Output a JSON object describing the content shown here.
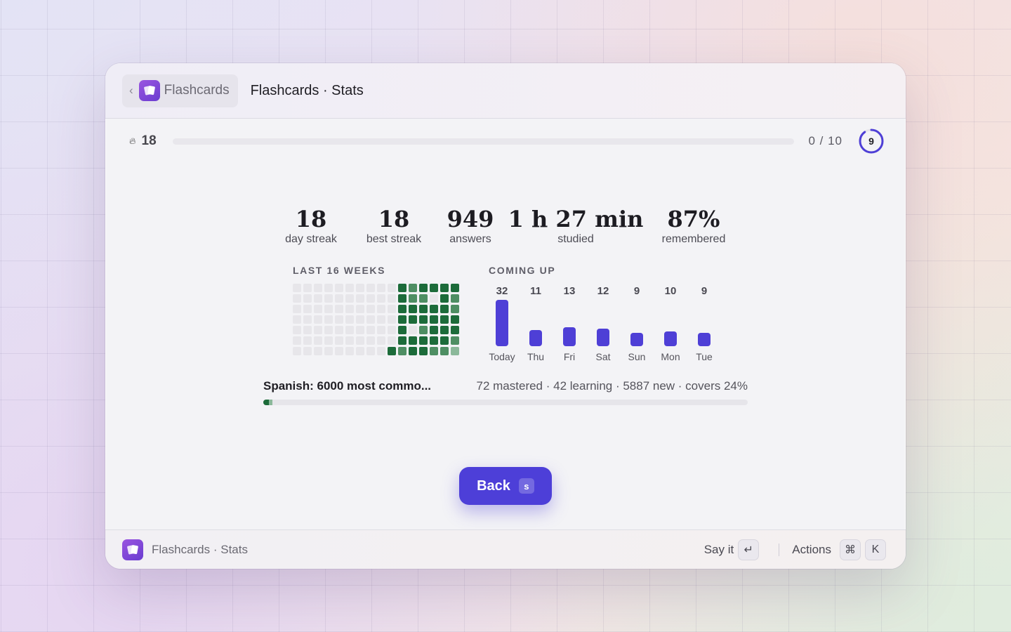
{
  "header": {
    "crumb_label": "Flashcards",
    "title": "Flashcards · Stats"
  },
  "progress": {
    "streak": "18",
    "count": "0 / 10",
    "ring_value": "9",
    "ring_fraction": 0.9,
    "accent": "#4e3fd6"
  },
  "stats": [
    {
      "value": "18",
      "label": "day streak"
    },
    {
      "value": "18",
      "label": "best streak"
    },
    {
      "value": "949",
      "label": "answers"
    },
    {
      "value": "1 h 27 min",
      "label": "studied"
    },
    {
      "value": "87%",
      "label": "remembered"
    }
  ],
  "heatmap": {
    "label": "LAST 16 WEEKS",
    "colors": {
      "0": "#e7e6ea",
      "1": "#8bb89a",
      "2": "#4e8e63",
      "3": "#1c6b3a"
    },
    "weeks": [
      [
        0,
        0,
        0,
        0,
        0,
        0,
        0
      ],
      [
        0,
        0,
        0,
        0,
        0,
        0,
        0
      ],
      [
        0,
        0,
        0,
        0,
        0,
        0,
        0
      ],
      [
        0,
        0,
        0,
        0,
        0,
        0,
        0
      ],
      [
        0,
        0,
        0,
        0,
        0,
        0,
        0
      ],
      [
        0,
        0,
        0,
        0,
        0,
        0,
        0
      ],
      [
        0,
        0,
        0,
        0,
        0,
        0,
        0
      ],
      [
        0,
        0,
        0,
        0,
        0,
        0,
        0
      ],
      [
        0,
        0,
        0,
        0,
        0,
        0,
        0
      ],
      [
        0,
        0,
        0,
        0,
        0,
        0,
        3
      ],
      [
        3,
        3,
        3,
        3,
        3,
        3,
        2
      ],
      [
        2,
        2,
        3,
        3,
        0,
        3,
        3
      ],
      [
        3,
        2,
        3,
        3,
        2,
        3,
        3
      ],
      [
        3,
        0,
        3,
        3,
        3,
        3,
        2
      ],
      [
        3,
        3,
        3,
        3,
        3,
        3,
        2
      ],
      [
        3,
        2,
        2,
        3,
        3,
        2,
        1
      ]
    ]
  },
  "coming_up": {
    "label": "COMING UP",
    "days": [
      {
        "day": "Today",
        "count": "32",
        "value": 32
      },
      {
        "day": "Thu",
        "count": "11",
        "value": 11
      },
      {
        "day": "Fri",
        "count": "13",
        "value": 13
      },
      {
        "day": "Sat",
        "count": "12",
        "value": 12
      },
      {
        "day": "Sun",
        "count": "9",
        "value": 9
      },
      {
        "day": "Mon",
        "count": "10",
        "value": 10
      },
      {
        "day": "Tue",
        "count": "9",
        "value": 9
      }
    ]
  },
  "deck": {
    "name": "Spanish: 6000 most commo...",
    "meta": "72 mastered · 42 learning · 5887 new · covers 24%",
    "mastered": 72,
    "learning": 42,
    "new": 5887
  },
  "back_button": {
    "label": "Back",
    "shortcut": "s"
  },
  "footer": {
    "title": "Flashcards · Stats",
    "say_label": "Say it",
    "say_key": "↵",
    "actions_label": "Actions",
    "actions_key1": "⌘",
    "actions_key2": "K"
  }
}
